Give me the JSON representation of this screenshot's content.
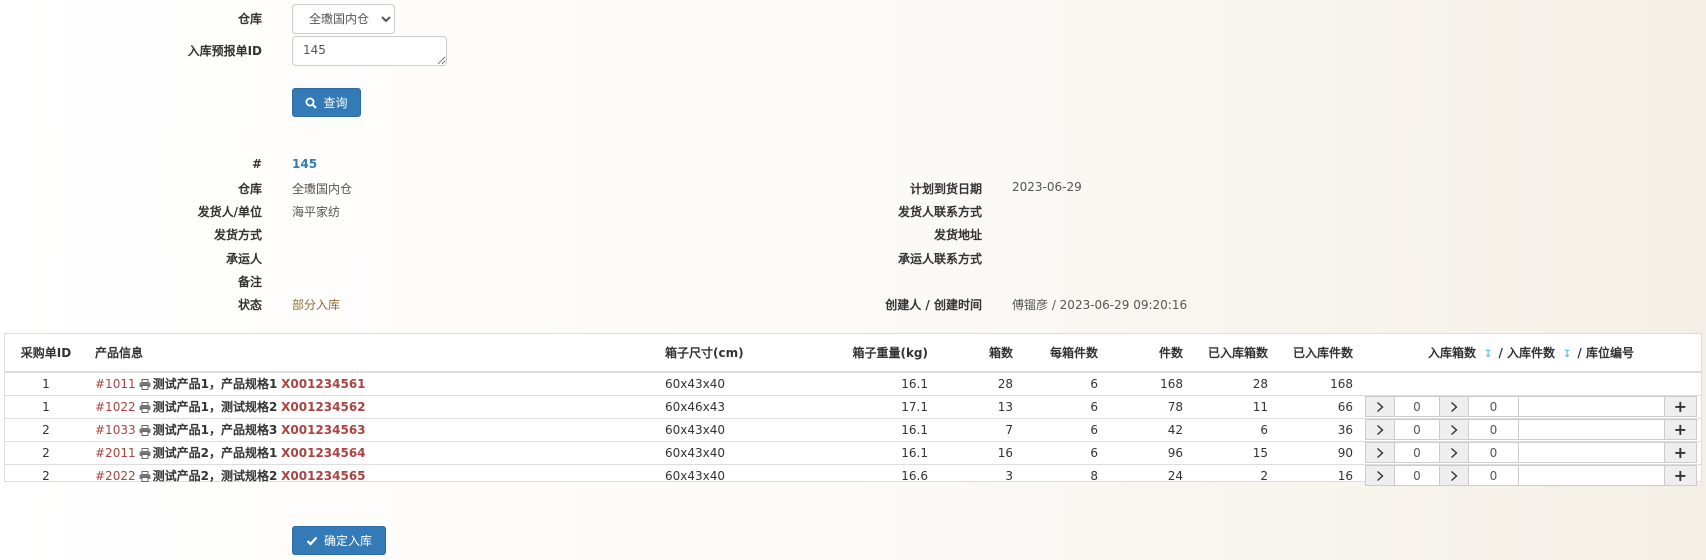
{
  "filter": {
    "warehouse_label": "仓库",
    "warehouse_value": "全璷国内仓",
    "preorder_label": "入库预报单ID",
    "preorder_value": "145",
    "query_label": "查询"
  },
  "detail": {
    "id_label": "#",
    "id_value": "145",
    "warehouse_label": "仓库",
    "warehouse_value": "全璷国内仓",
    "shipper_label": "发货人/单位",
    "shipper_value": "海平家纺",
    "ship_method_label": "发货方式",
    "ship_method_value": "",
    "carrier_label": "承运人",
    "carrier_value": "",
    "remark_label": "备注",
    "remark_value": "",
    "status_label": "状态",
    "status_value": "部分入库",
    "planned_date_label": "计划到货日期",
    "planned_date_value": "2023-06-29",
    "shipper_contact_label": "发货人联系方式",
    "ship_address_label": "发货地址",
    "carrier_contact_label": "承运人联系方式",
    "creator_label": "创建人 / 创建时间",
    "creator_value": "傅镏彦 / 2023-06-29 09:20:16"
  },
  "table": {
    "headers": {
      "po_id": "采购单ID",
      "product": "产品信息",
      "box_size": "箱子尺寸(cm)",
      "box_weight": "箱子重量(kg)",
      "boxes": "箱数",
      "per_box": "每箱件数",
      "pieces": "件数",
      "in_boxes": "已入库箱数",
      "in_pieces": "已入库件数",
      "inbound_boxes": "入库箱数",
      "inbound_pieces": "/ 入库件数",
      "location": "/ 库位编号"
    },
    "rows": [
      {
        "po_id": "1",
        "product_no": "#1011",
        "product_name": "测试产品1，产品规格1",
        "sku": "X001234561",
        "box_size": "60x43x40",
        "box_weight": "16.1",
        "boxes": "28",
        "per_box": "6",
        "pieces": "168",
        "in_boxes": "28",
        "in_pieces": "168",
        "has_input": false
      },
      {
        "po_id": "1",
        "product_no": "#1022",
        "product_name": "测试产品1，测试规格2",
        "sku": "X001234562",
        "box_size": "60x46x43",
        "box_weight": "17.1",
        "boxes": "13",
        "per_box": "6",
        "pieces": "78",
        "in_boxes": "11",
        "in_pieces": "66",
        "has_input": true,
        "input_boxes": "0",
        "input_pieces": "0",
        "input_location": ""
      },
      {
        "po_id": "2",
        "product_no": "#1033",
        "product_name": "测试产品1，产品规格3",
        "sku": "X001234563",
        "box_size": "60x43x40",
        "box_weight": "16.1",
        "boxes": "7",
        "per_box": "6",
        "pieces": "42",
        "in_boxes": "6",
        "in_pieces": "36",
        "has_input": true,
        "input_boxes": "0",
        "input_pieces": "0",
        "input_location": ""
      },
      {
        "po_id": "2",
        "product_no": "#2011",
        "product_name": "测试产品2，产品规格1",
        "sku": "X001234564",
        "box_size": "60x43x40",
        "box_weight": "16.1",
        "boxes": "16",
        "per_box": "6",
        "pieces": "96",
        "in_boxes": "15",
        "in_pieces": "90",
        "has_input": true,
        "input_boxes": "0",
        "input_pieces": "0",
        "input_location": ""
      },
      {
        "po_id": "2",
        "product_no": "#2022",
        "product_name": "测试产品2，测试规格2",
        "sku": "X001234565",
        "box_size": "60x43x40",
        "box_weight": "16.6",
        "boxes": "3",
        "per_box": "8",
        "pieces": "24",
        "in_boxes": "2",
        "in_pieces": "16",
        "has_input": true,
        "input_boxes": "0",
        "input_pieces": "0",
        "input_location": ""
      }
    ]
  },
  "confirm_label": "确定入库",
  "colors": {
    "primary": "#337ab7",
    "sku": "#a94442",
    "status": "#8a6d3b",
    "id_link": "#337ab7",
    "arrow": "#5bc0de"
  }
}
